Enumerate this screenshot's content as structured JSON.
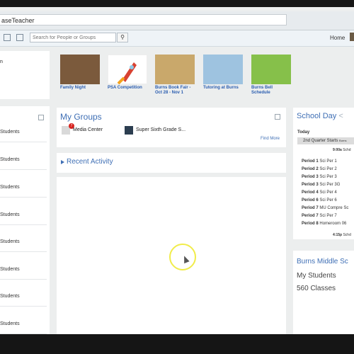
{
  "window": {
    "url_text": "aseTeacher"
  },
  "toolbar": {
    "search_placeholder": "Search for People or Groups",
    "home_label": "Home"
  },
  "links": [
    {
      "caption": "Family Night",
      "color": "#7b5a3c"
    },
    {
      "caption": "PSA Competition",
      "color": "#ffffff"
    },
    {
      "caption": "Burns Book Fair - Oct 28 - Nov 1",
      "color": "#c9a86b"
    },
    {
      "caption": "Tutoring at Burns",
      "color": "#9ec3e0"
    },
    {
      "caption": "Burns Bell Schedule",
      "color": "#86c04a"
    }
  ],
  "left_top": {
    "label": "n"
  },
  "left_rows": [
    "Students",
    "Students",
    "Students",
    "Students",
    "Students",
    "Students",
    "Students",
    "Students"
  ],
  "groups": {
    "title": "My Groups",
    "items": [
      {
        "label": "Media Center",
        "badge": "7"
      },
      {
        "label": "Super Sixth Grade S..."
      }
    ],
    "find_more": "Find More"
  },
  "recent": {
    "title": "Recent Activity"
  },
  "school_day": {
    "title": "School Day",
    "today_label": "Today",
    "quarter": "2nd Quarter Starts",
    "quarter_suffix": "Burns",
    "start_time": "9:00a",
    "start_suffix": "Schd",
    "periods": [
      {
        "label": "Period 1",
        "class": "Sci Per 1"
      },
      {
        "label": "Period 2",
        "class": "Sci Per 2"
      },
      {
        "label": "Period 3",
        "class": "Sci Per 3"
      },
      {
        "label": "Period 3",
        "class": "Sci Per 3G"
      },
      {
        "label": "Period 4",
        "class": "Sci Per 4"
      },
      {
        "label": "Period 6",
        "class": "Sci Per 6"
      },
      {
        "label": "Period 7",
        "class": "MU Compre Sc"
      },
      {
        "label": "Period 7",
        "class": "Sci Per 7"
      },
      {
        "label": "Period 8",
        "class": "Homeroom 06"
      }
    ],
    "end_time": "4:15p",
    "end_suffix": "Schd"
  },
  "school_info": {
    "name": "Burns Middle Sc",
    "students": "My Students",
    "classes": "560 Classes"
  }
}
